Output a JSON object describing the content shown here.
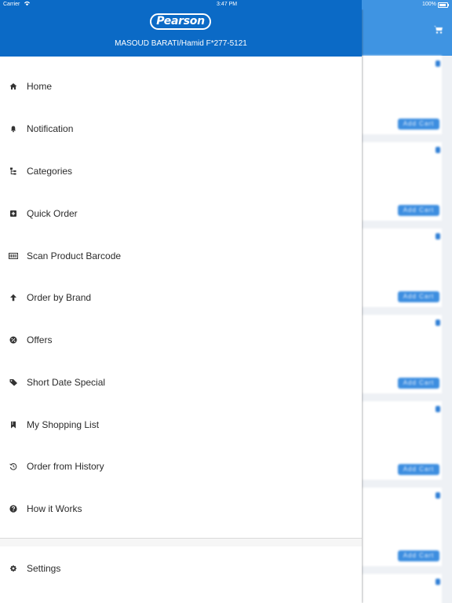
{
  "status_bar": {
    "carrier": "Carrier",
    "time": "3:47 PM",
    "battery": "100%"
  },
  "drawer": {
    "logo_text": "Pearson",
    "user_line": "MASOUD BARATI/Hamid F*277-5121",
    "menu": [
      {
        "label": "Home",
        "icon": "home-icon"
      },
      {
        "label": "Notification",
        "icon": "bell-icon"
      },
      {
        "label": "Categories",
        "icon": "hierarchy-icon"
      },
      {
        "label": "Quick Order",
        "icon": "plus-square-icon"
      },
      {
        "label": "Scan Product Barcode",
        "icon": "barcode-icon"
      },
      {
        "label": "Order by Brand",
        "icon": "arrow-up-icon"
      },
      {
        "label": "Offers",
        "icon": "percent-badge-icon"
      },
      {
        "label": "Short Date Special",
        "icon": "tags-icon"
      },
      {
        "label": "My Shopping List",
        "icon": "bookmark-icon"
      },
      {
        "label": "Order from History",
        "icon": "history-icon"
      },
      {
        "label": "How it Works",
        "icon": "question-circle-icon"
      }
    ],
    "settings": {
      "label": "Settings",
      "icon": "gear-icon"
    }
  },
  "background": {
    "add_cart_label": "Add Cart"
  },
  "colors": {
    "header_blue": "#0b6ac6",
    "background_header_blue": "#3f94e2",
    "menu_text": "#2b2b2b"
  }
}
